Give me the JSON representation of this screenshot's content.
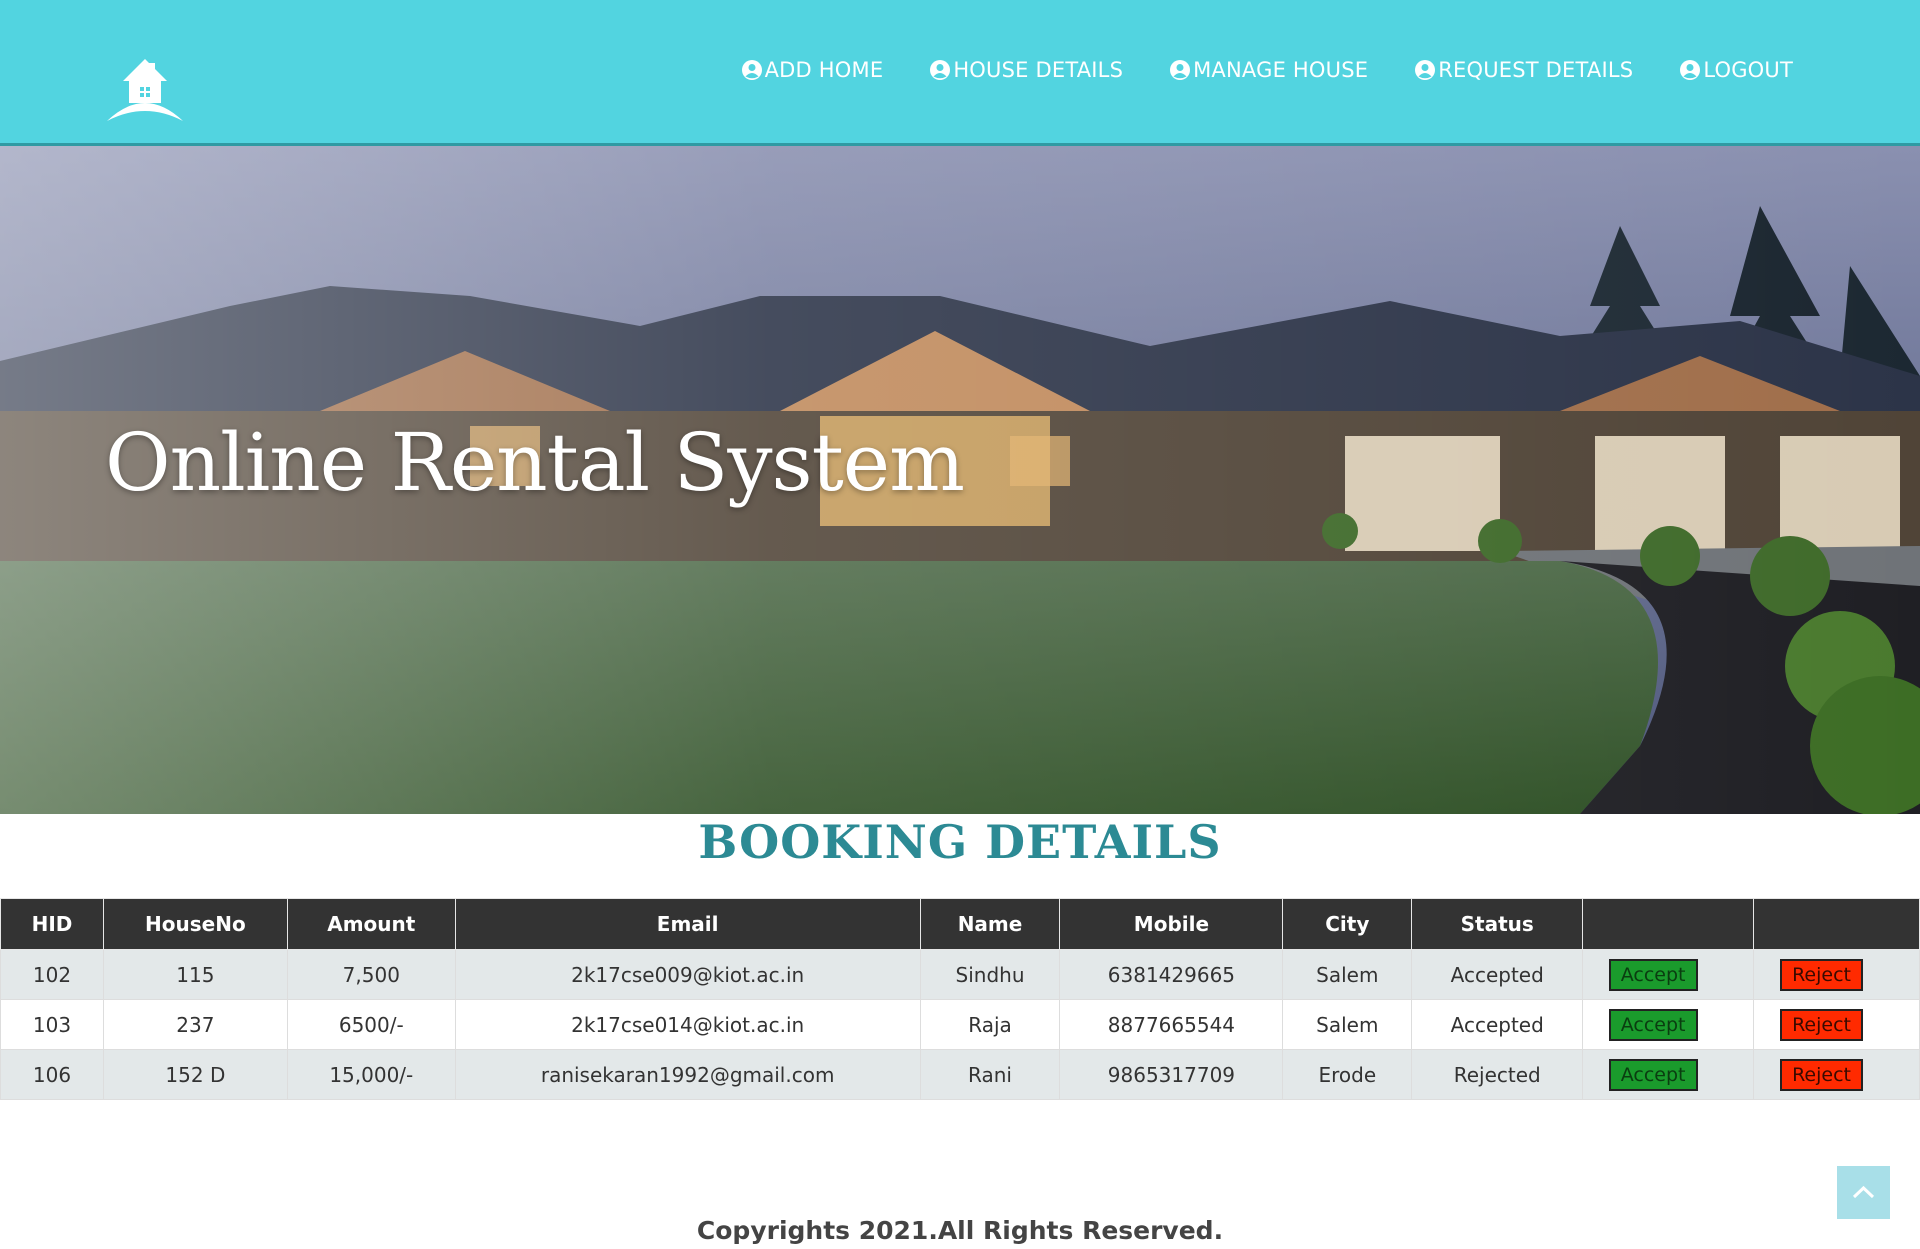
{
  "nav": {
    "items": [
      {
        "label": "ADD HOME"
      },
      {
        "label": "HOUSE DETAILS"
      },
      {
        "label": "MANAGE HOUSE"
      },
      {
        "label": "REQUEST DETAILS"
      },
      {
        "label": "LOGOUT"
      }
    ]
  },
  "hero": {
    "title": "Online Rental System"
  },
  "section": {
    "title": "BOOKING DETAILS"
  },
  "table": {
    "headers": [
      "HID",
      "HouseNo",
      "Amount",
      "Email",
      "Name",
      "Mobile",
      "City",
      "Status",
      "",
      ""
    ],
    "rows": [
      {
        "hid": "102",
        "houseno": "115",
        "amount": "7,500",
        "email": "2k17cse009@kiot.ac.in",
        "name": "Sindhu",
        "mobile": "6381429665",
        "city": "Salem",
        "status": "Accepted",
        "accept": "Accept",
        "reject": "Reject"
      },
      {
        "hid": "103",
        "houseno": "237",
        "amount": "6500/-",
        "email": "2k17cse014@kiot.ac.in",
        "name": "Raja",
        "mobile": "8877665544",
        "city": "Salem",
        "status": "Accepted",
        "accept": "Accept",
        "reject": "Reject"
      },
      {
        "hid": "106",
        "houseno": "152 D",
        "amount": "15,000/-",
        "email": "ranisekaran1992@gmail.com",
        "name": "Rani",
        "mobile": "9865317709",
        "city": "Erode",
        "status": "Rejected",
        "accept": "Accept",
        "reject": "Reject"
      }
    ]
  },
  "footer": {
    "text": "Copyrights 2021.All Rights Reserved."
  },
  "icons": {
    "logo": "house-logo-icon",
    "nav": "user-circle-icon",
    "scroll_top": "chevron-up-icon"
  },
  "colors": {
    "header_bg": "#52d4e0",
    "title_teal": "#2c8a94",
    "table_header_bg": "#333333",
    "accept_green": "#1a9b2c",
    "reject_red": "#ff2a00"
  }
}
